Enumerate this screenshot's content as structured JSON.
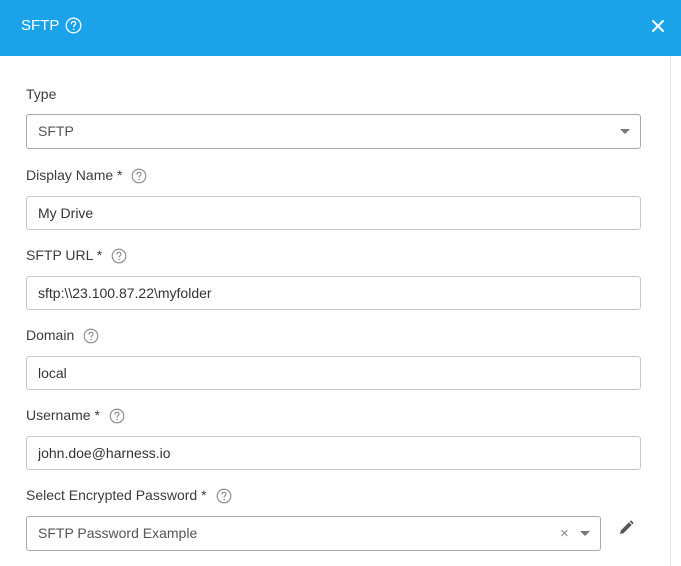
{
  "header": {
    "title": "SFTP",
    "help_icon": "question-circle-icon",
    "close_icon": "close-icon",
    "background": "#1ba3ea"
  },
  "form": {
    "type": {
      "label": "Type",
      "value": "SFTP"
    },
    "display_name": {
      "label": "Display Name *",
      "value": "My Drive"
    },
    "sftp_url": {
      "label": "SFTP URL *",
      "value": "sftp:\\\\23.100.87.22\\myfolder"
    },
    "domain": {
      "label": "Domain",
      "value": "local"
    },
    "username": {
      "label": "Username *",
      "value": "john.doe@harness.io"
    },
    "password": {
      "label": "Select Encrypted Password *",
      "value": "SFTP Password Example",
      "clear_glyph": "×"
    }
  },
  "icons": {
    "help": "question-circle-icon",
    "edit": "pencil-icon"
  }
}
